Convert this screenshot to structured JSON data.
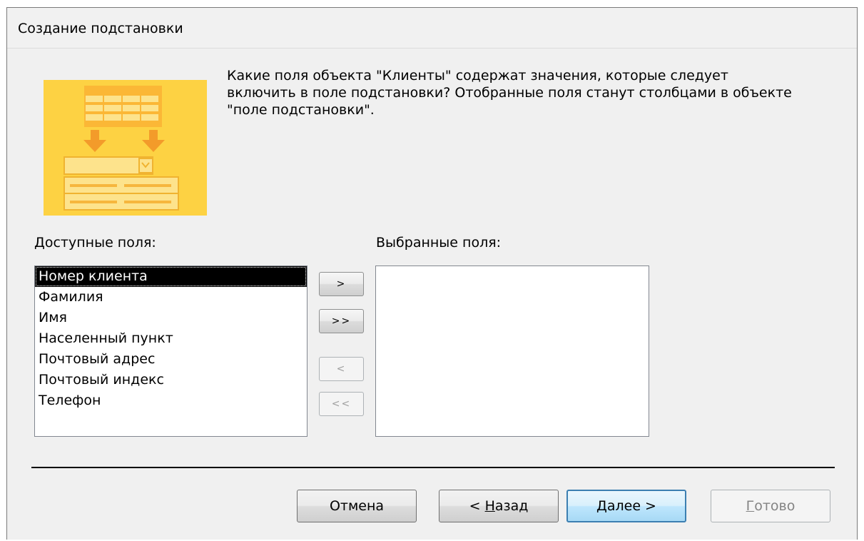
{
  "window": {
    "title": "Создание подстановки"
  },
  "wizard": {
    "question": "Какие поля объекта \"Клиенты\" содержат значения, которые следует включить в поле подстановки? Отобранные поля станут столбцами в объекте \"поле подстановки\".",
    "image_icon": "lookup-wizard-icon"
  },
  "available": {
    "label": "Доступные поля:",
    "items": [
      "Номер клиента",
      "Фамилия",
      "Имя",
      "Населенный пункт",
      "Почтовый адрес",
      "Почтовый индекс",
      "Телефон"
    ],
    "selected_index": 0
  },
  "selected": {
    "label": "Выбранные поля:",
    "items": []
  },
  "move_buttons": {
    "add_one": ">",
    "add_all": ">>",
    "remove_one": "<",
    "remove_all": "<<"
  },
  "footer": {
    "cancel": "Отмена",
    "back_prefix": "< ",
    "back_key": "Н",
    "back_rest": "азад",
    "next_key": "Д",
    "next_rest": "алее >",
    "finish_key": "Г",
    "finish_rest": "отово"
  },
  "colors": {
    "accent_border": "#3c7fb1",
    "wizard_image": "#fdd243"
  }
}
